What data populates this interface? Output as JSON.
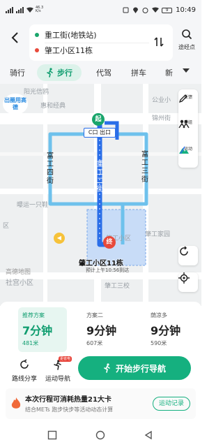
{
  "status_bar": {
    "net_speed_value": "46.3",
    "net_speed_unit": "K/s",
    "battery": "9",
    "time": "10:49"
  },
  "header": {
    "origin": "重工街(地铁站)",
    "destination": "肇工小区11栋",
    "waypoint_label": "途经点"
  },
  "tabs": {
    "cycling": "骑行",
    "walking": "步行",
    "driver": "代驾",
    "carpool": "拼车",
    "new": "新"
  },
  "map": {
    "poi_top": "阳光信鸥",
    "poi_hui": "惠和经典",
    "poi_gongye": "公业小",
    "poi_jinzhou": "锦州街",
    "poi_hao": "曝运一只鞋",
    "poi_a": "区",
    "poi_zhaogong_park": "肇工家园",
    "poi_sanxiao": "肇工三校",
    "poi_xiaoqu": "肇工小区",
    "street_left": "富工四街",
    "street_mid": "重工二街",
    "street_right": "富工三街",
    "exit_label": "C口 出口",
    "start_pin": "起",
    "end_pin": "终",
    "destination_label": "肇工小区11栋",
    "eta_label": "预计上午10:56到达",
    "promo_badge": "出圈用高德",
    "logo": "高德地图",
    "bottom_label": "社宫小区",
    "tool_feedback": "反馈",
    "tool_group": "群组",
    "tool_sport": "运动"
  },
  "plans": [
    {
      "name": "推荐方案",
      "time": "7分钟",
      "distance": "481米"
    },
    {
      "name": "方案二",
      "time": "9分钟",
      "distance": "607米"
    },
    {
      "name": "荫凉多",
      "time": "9分钟",
      "distance": "590米"
    }
  ],
  "actions": {
    "share": "路线分享",
    "sport_nav": "运动导航",
    "new_badge": "更省电",
    "start_nav": "开始步行导航"
  },
  "banner": {
    "title": "本次行程可消耗热量21大卡",
    "subtitle": "结合METs 跑步快步等活动动态计算",
    "button": "运动记录"
  },
  "colors": {
    "accent": "#15b07f",
    "route": "#2a6ee8",
    "route_alt": "#6ec1ec",
    "destination_pin": "#e84a3b"
  }
}
